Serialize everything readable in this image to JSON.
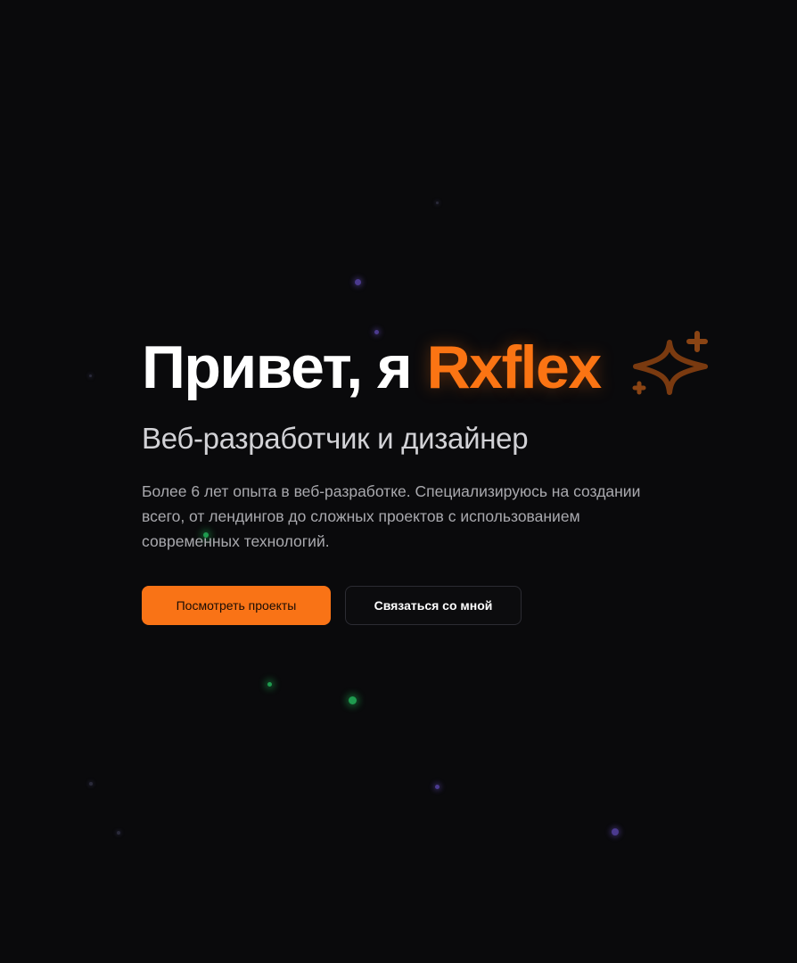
{
  "hero": {
    "greeting": "Привет, я ",
    "name": "Rxflex",
    "subtitle": "Веб-разработчик и дизайнер",
    "description": "Более 6 лет опыта в веб-разработке. Специализируюсь на создании всего, от лендингов до сложных проектов с использованием современных технологий."
  },
  "actions": {
    "primary_label": "Посмотреть проекты",
    "secondary_label": "Связаться со мной"
  },
  "decor": {
    "sparkle_icon": "sparkle-icon",
    "accent_color": "#f97316",
    "background_color": "#0a0a0c"
  }
}
